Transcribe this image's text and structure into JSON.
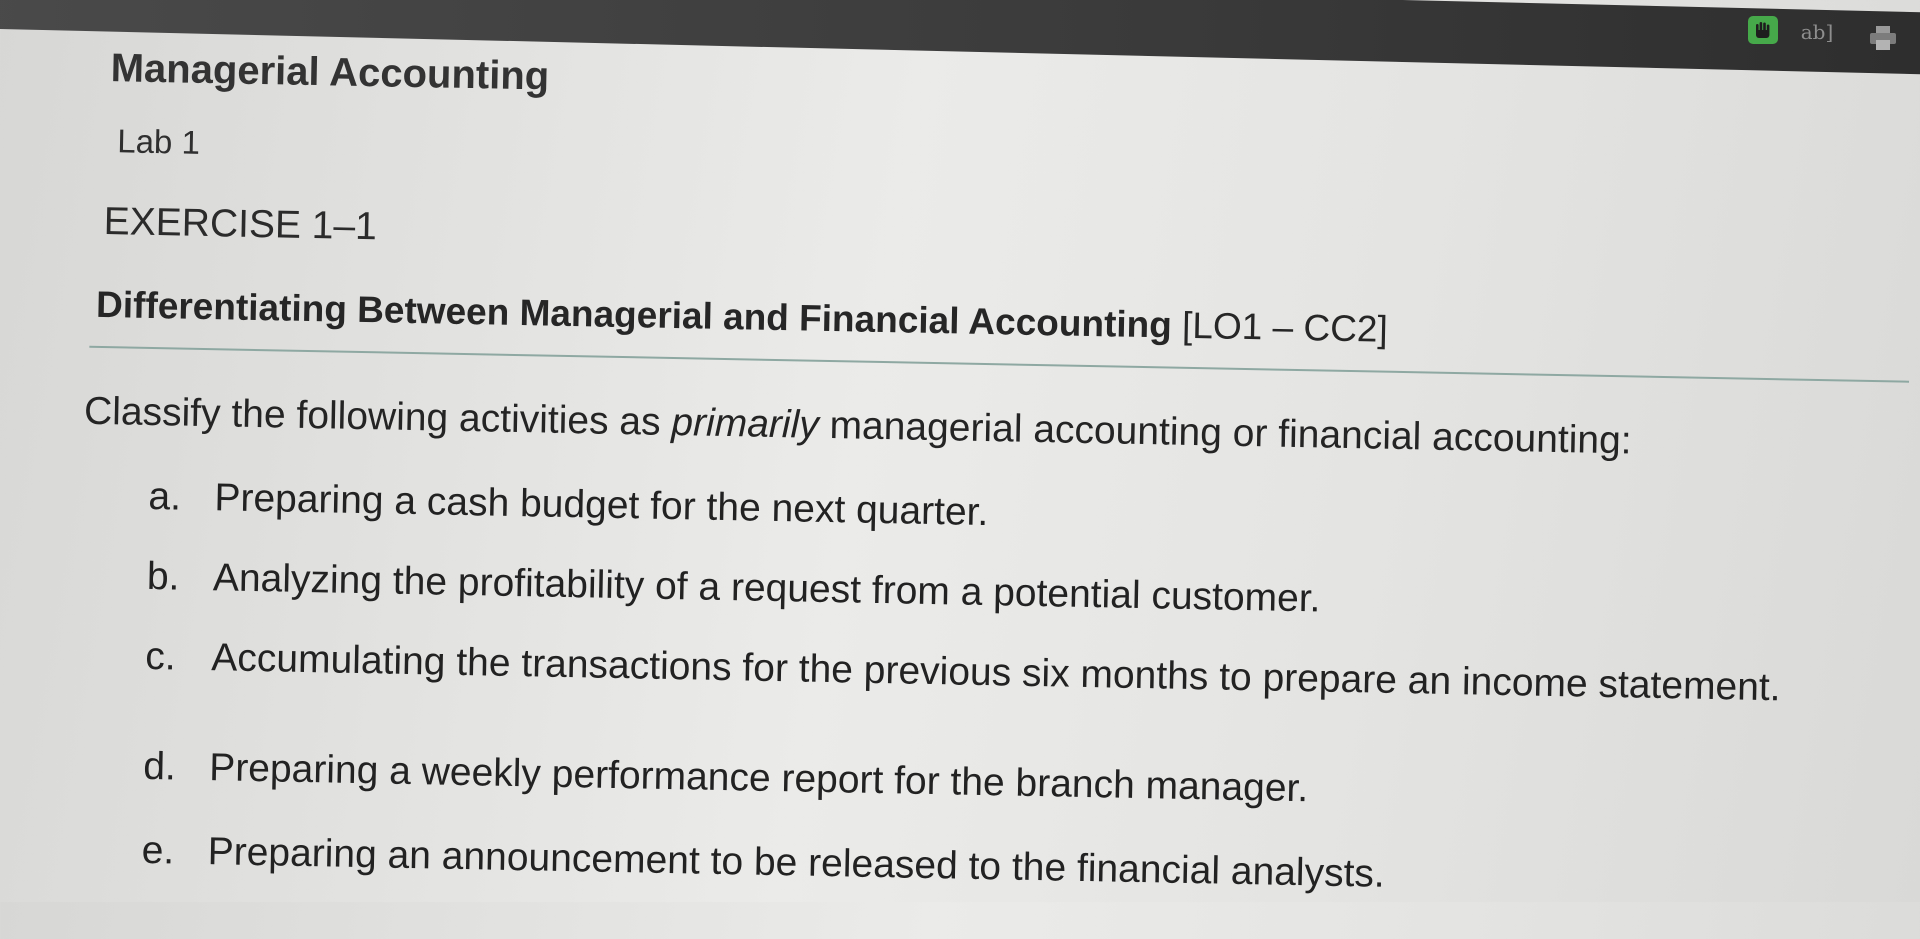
{
  "toolbar": {
    "icons": [
      {
        "name": "hand-icon",
        "color": "#46a94a"
      },
      {
        "name": "text-select-icon",
        "label": "ab]"
      },
      {
        "name": "print-icon"
      }
    ]
  },
  "document": {
    "course_title": "Managerial Accounting",
    "lab_label": "Lab 1",
    "exercise_label": "EXERCISE 1–1",
    "section_heading": "Differentiating Between Managerial and Financial Accounting",
    "section_code": "[LO1 – CC2]",
    "instructions": {
      "before": "Classify the following activities as ",
      "emphasis": "primarily",
      "after": " managerial accounting or financial accounting:"
    },
    "items": [
      {
        "letter": "a.",
        "text": "Preparing a cash budget for the next quarter."
      },
      {
        "letter": "b.",
        "text": "Analyzing the profitability of a request from a potential customer."
      },
      {
        "letter": "c.",
        "text": "Accumulating the transactions for the previous six months to prepare an income statement."
      },
      {
        "letter": "d.",
        "text": "Preparing a weekly performance report for the branch manager."
      },
      {
        "letter": "e.",
        "text": "Preparing an announcement to be released to the financial analysts."
      }
    ]
  }
}
